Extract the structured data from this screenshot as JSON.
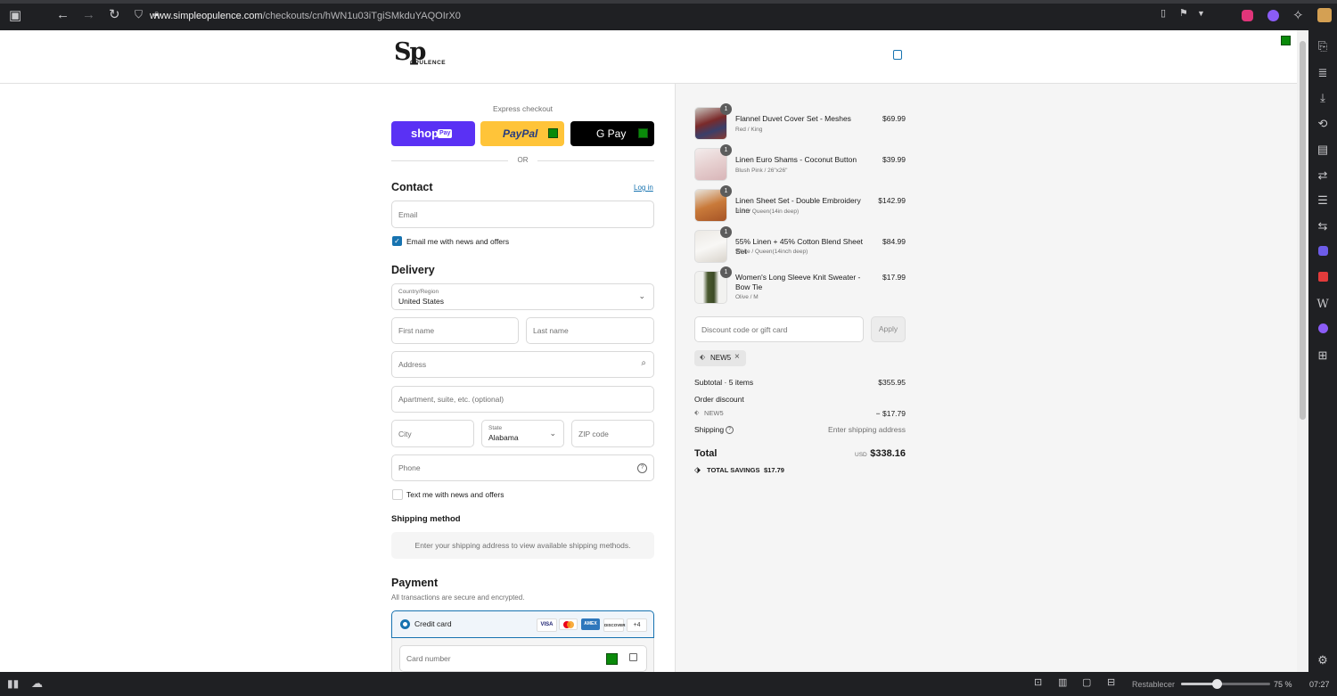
{
  "browser": {
    "url_domain": "www.simpleopulence.com",
    "url_path": "/checkouts/cn/hWN1u03iTgiSMkduYAQOIrX0",
    "status_right": "Restablecer",
    "zoom": "75 %",
    "time": "07:27",
    "zoom_level": 0.4
  },
  "store": {
    "logo_text": "Sp",
    "logo_sub": "OPULENCE"
  },
  "express": {
    "title": "Express checkout",
    "shop_label": "shop",
    "shop_badge": "Pay",
    "paypal_label": "PayPal",
    "gpay_label": "G Pay",
    "or_label": "OR"
  },
  "contact": {
    "title": "Contact",
    "login_link": "Log in",
    "email_placeholder": "Email",
    "newsletter_label": "Email me with news and offers",
    "newsletter_checked": true
  },
  "delivery": {
    "title": "Delivery",
    "country_label": "Country/Region",
    "country_value": "United States",
    "first_name_placeholder": "First name",
    "last_name_placeholder": "Last name",
    "address_placeholder": "Address",
    "apartment_placeholder": "Apartment, suite, etc. (optional)",
    "city_placeholder": "City",
    "state_label": "State",
    "state_value": "Alabama",
    "zip_placeholder": "ZIP code",
    "phone_placeholder": "Phone",
    "sms_label": "Text me with news and offers"
  },
  "shipping_method": {
    "title": "Shipping method",
    "message": "Enter your shipping address to view available shipping methods."
  },
  "payment": {
    "title": "Payment",
    "subtitle": "All transactions are secure and encrypted.",
    "credit_card_label": "Credit card",
    "cards": [
      "VISA",
      "MC",
      "AMEX",
      "DISCOVER"
    ],
    "more_cards": "+4",
    "card_number_placeholder": "Card number"
  },
  "order": {
    "items": [
      {
        "qty": "1",
        "name": "Flannel Duvet Cover Set - Meshes",
        "variant": "Red / King",
        "price": "$69.99"
      },
      {
        "qty": "1",
        "name": "Linen Euro Shams - Coconut Button",
        "variant": "Blush Pink / 26\"x26\"",
        "price": "$39.99"
      },
      {
        "qty": "1",
        "name": "Linen Sheet Set - Double Embroidery Line",
        "variant": "Rust / Queen(14in deep)",
        "price": "$142.99"
      },
      {
        "qty": "1",
        "name": "55% Linen + 45% Cotton Blend Sheet Set",
        "variant": "White / Queen(14inch deep)",
        "price": "$84.99"
      },
      {
        "qty": "1",
        "name": "Women's Long Sleeve Knit Sweater - Bow Tie",
        "variant": "Olive / M",
        "price": "$17.99"
      }
    ],
    "discount_placeholder": "Discount code or gift card",
    "apply_label": "Apply",
    "applied_code": "NEW5",
    "subtotal_label": "Subtotal · 5 items",
    "subtotal_value": "$355.95",
    "order_discount_label": "Order discount",
    "discount_code": "NEW5",
    "discount_value": "− $17.79",
    "shipping_label": "Shipping",
    "shipping_value": "Enter shipping address",
    "total_label": "Total",
    "currency": "USD",
    "total_value": "$338.16",
    "savings_label": "TOTAL SAVINGS",
    "savings_value": "$17.79"
  }
}
